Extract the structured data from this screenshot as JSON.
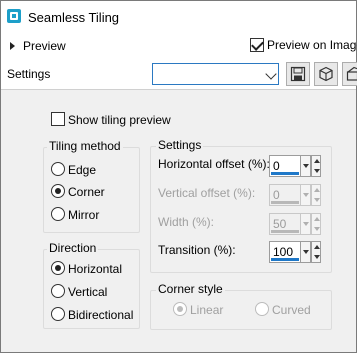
{
  "window": {
    "title": "Seamless Tiling"
  },
  "preview": {
    "label": "Preview",
    "preview_on_image_label": "Preview on Image",
    "preview_on_image_checked": true
  },
  "settings_bar": {
    "label": "Settings",
    "preset_value": ""
  },
  "show_tiling_preview": {
    "label": "Show tiling preview",
    "checked": false
  },
  "tiling_method": {
    "title": "Tiling method",
    "options": [
      {
        "label": "Edge",
        "selected": false
      },
      {
        "label": "Corner",
        "selected": true
      },
      {
        "label": "Mirror",
        "selected": false
      }
    ]
  },
  "direction": {
    "title": "Direction",
    "options": [
      {
        "label": "Horizontal",
        "selected": true
      },
      {
        "label": "Vertical",
        "selected": false
      },
      {
        "label": "Bidirectional",
        "selected": false
      }
    ]
  },
  "settings_group": {
    "title": "Settings",
    "fields": [
      {
        "label": "Horizontal offset (%):",
        "value": "0",
        "enabled": true
      },
      {
        "label": "Vertical offset (%):",
        "value": "0",
        "enabled": false
      },
      {
        "label": "Width (%):",
        "value": "50",
        "enabled": false
      },
      {
        "label": "Transition (%):",
        "value": "100",
        "enabled": true
      }
    ]
  },
  "corner_style": {
    "title": "Corner style",
    "options": [
      {
        "label": "Linear",
        "selected": true,
        "enabled": false
      },
      {
        "label": "Curved",
        "selected": false,
        "enabled": false
      }
    ]
  },
  "icons": {
    "app": "app-tiling-icon",
    "save": "save-icon",
    "cube": "cube-icon",
    "extra": "toolbar-extra-icon"
  },
  "colors": {
    "accent": "#1f78c8",
    "background": "#f0f0f0",
    "app_icon": "#1d9fc9"
  }
}
